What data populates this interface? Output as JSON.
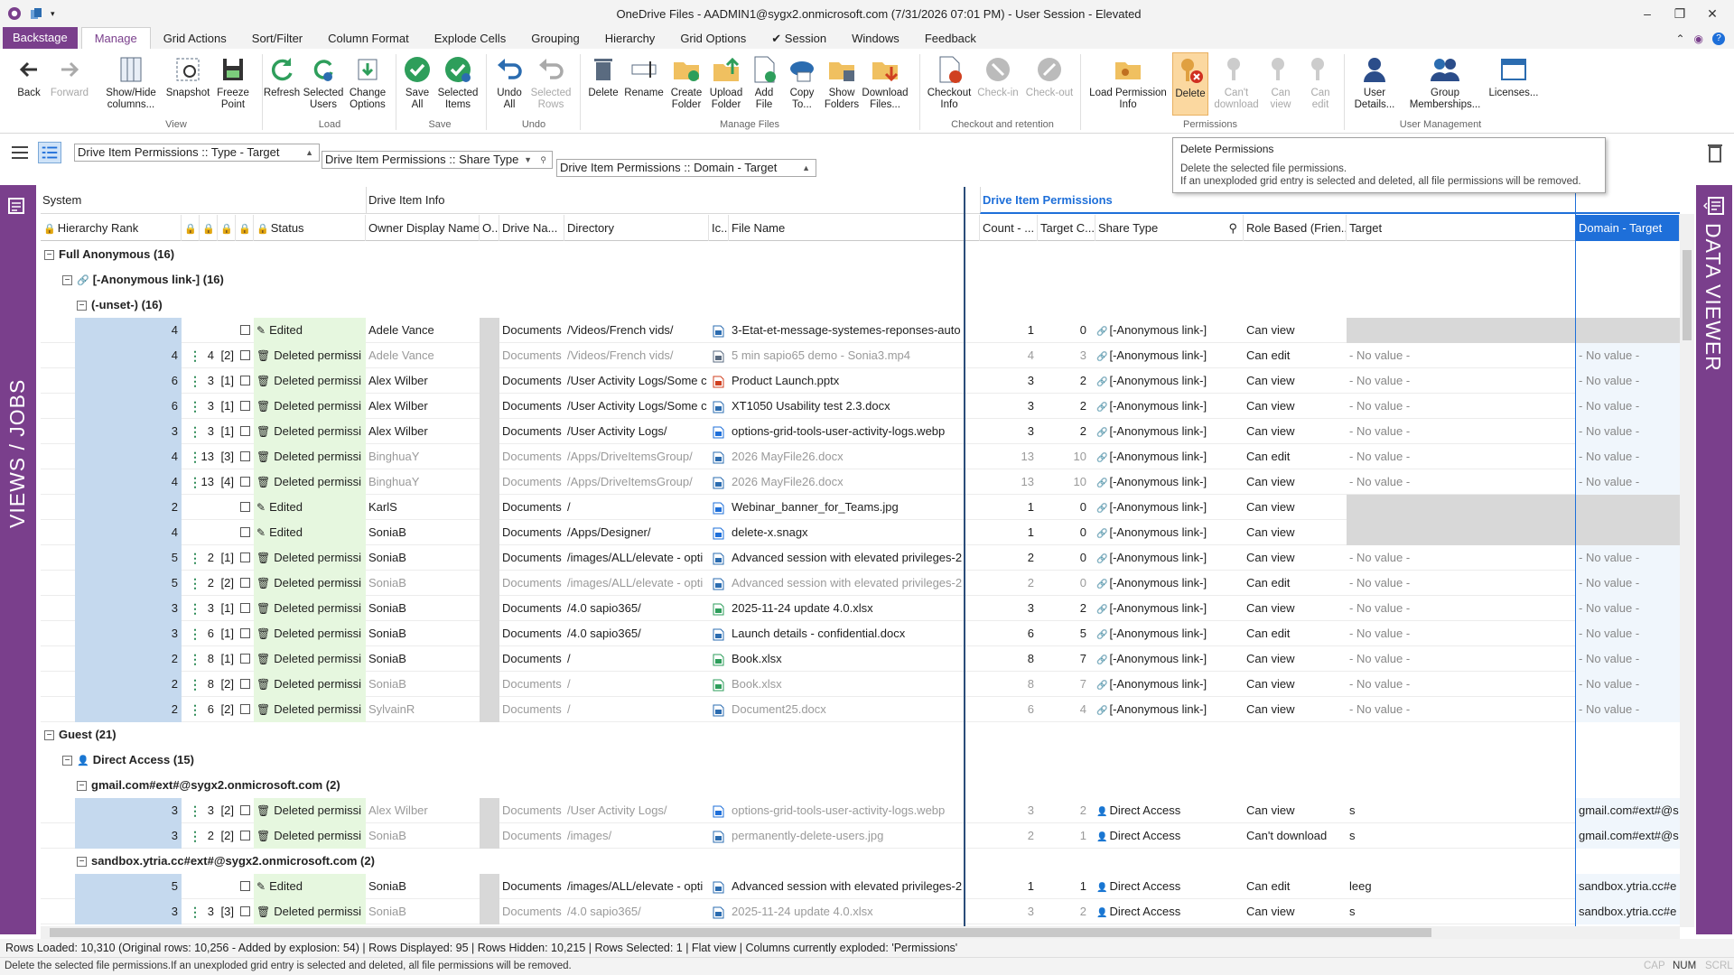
{
  "window": {
    "title": "OneDrive Files - AADMIN1@sygx2.onmicrosoft.com (7/31/2026 07:01 PM) - User Session - Elevated",
    "controls": [
      "–",
      "❐",
      "✕"
    ]
  },
  "tabs": [
    "Backstage",
    "Manage",
    "Grid Actions",
    "Sort/Filter",
    "Column Format",
    "Explode Cells",
    "Grouping",
    "Hierarchy",
    "Grid Options",
    "✔ Session",
    "Windows",
    "Feedback"
  ],
  "ribbon": {
    "groups": [
      "View",
      "Load",
      "Save",
      "Undo",
      "Manage Files",
      "Checkout and retention",
      "Permissions",
      "User Management"
    ],
    "buttons": {
      "back": "Back",
      "forward": "Forward",
      "show_hide": "Show/Hide columns...",
      "snapshot": "Snapshot",
      "freeze": "Freeze Point",
      "refresh": "Refresh",
      "selected_users": "Selected Users",
      "change_options": "Change Options",
      "save_all": "Save All",
      "selected_items": "Selected Items",
      "undo_all": "Undo All",
      "selected_rows": "Selected Rows",
      "delete_file": "Delete",
      "rename": "Rename",
      "create_folder": "Create Folder",
      "upload_folder": "Upload Folder",
      "add_file": "Add File",
      "copy_to": "Copy To...",
      "show_folders": "Show Folders",
      "download_files": "Download Files...",
      "checkout_info": "Checkout Info",
      "checkin": "Check-in",
      "checkout": "Check-out",
      "load_perm": "Load Permission Info",
      "delete_perm": "Delete",
      "cant_download": "Can't download",
      "can_view": "Can view",
      "can_edit": "Can edit",
      "user_details": "User Details...",
      "group_memberships": "Group Memberships...",
      "licenses": "Licenses..."
    }
  },
  "tooltip": {
    "title": "Delete Permissions",
    "line1": "Delete the selected file permissions.",
    "line2": "If an unexploded grid entry is selected and deleted, all file permissions will be removed."
  },
  "groupby": {
    "chip1": "Drive Item Permissions :: Type - Target",
    "chip2": "Drive Item Permissions :: Share Type",
    "chip3": "Drive Item Permissions :: Domain - Target"
  },
  "side": {
    "left": "VIEWS / JOBS",
    "right": "DATA VIEWER"
  },
  "grid": {
    "categories": [
      "System",
      "Drive Item Info",
      "Drive Item Permissions"
    ],
    "headers": {
      "hierarchy_rank": "Hierarchy Rank",
      "status": "Status",
      "owner": "Owner Display Name",
      "o": "O...",
      "drive_name": "Drive Na...",
      "directory": "Directory",
      "icon": "Ic...",
      "file_name": "File Name",
      "count": "Count - ...",
      "target_c": "Target C...",
      "share_type": "Share Type",
      "role": "Role Based (Frien...",
      "target": "Target",
      "domain": "Domain - Target"
    },
    "groups": {
      "full_anon": "Full Anonymous (16)",
      "anon_link": "[-Anonymous link-] (16)",
      "unset": "(-unset-) (16)",
      "guest": "Guest (21)",
      "direct": "Direct Access (15)",
      "gmail": "gmail.com#ext#@sygx2.onmicrosoft.com (2)",
      "sandbox": "sandbox.ytria.cc#ext#@sygx2.onmicrosoft.com (2)"
    },
    "rows_block1": [
      {
        "rank": "4",
        "a": "",
        "b": "",
        "status": "Edited",
        "owner": "Adele Vance",
        "drive": "Documents",
        "dir": "/Videos/French vids/",
        "file": "3-Etat-et-message-systemes-reponses-auto",
        "count": "1",
        "tc": "0",
        "share": "[-Anonymous link-]",
        "role": "Can view",
        "target": "",
        "domain": "",
        "dim": false,
        "tgrey": true
      },
      {
        "rank": "4",
        "a": "4",
        "b": "[2]",
        "status": "Deleted permissi",
        "owner": "Adele Vance",
        "drive": "Documents",
        "dir": "/Videos/French vids/",
        "file": "5 min sapio65 demo - Sonia3.mp4",
        "count": "4",
        "tc": "3",
        "share": "[-Anonymous link-]",
        "role": "Can edit",
        "target": "- No value -",
        "domain": "- No value -",
        "dim": true,
        "tgrey": false
      },
      {
        "rank": "6",
        "a": "3",
        "b": "[1]",
        "status": "Deleted permissi",
        "owner": "Alex Wilber",
        "drive": "Documents",
        "dir": "/User Activity Logs/Some c",
        "file": "Product Launch.pptx",
        "count": "3",
        "tc": "2",
        "share": "[-Anonymous link-]",
        "role": "Can view",
        "target": "- No value -",
        "domain": "- No value -",
        "dim": false,
        "tgrey": false
      },
      {
        "rank": "6",
        "a": "3",
        "b": "[1]",
        "status": "Deleted permissi",
        "owner": "Alex Wilber",
        "drive": "Documents",
        "dir": "/User Activity Logs/Some c",
        "file": "XT1050 Usability test 2.3.docx",
        "count": "3",
        "tc": "2",
        "share": "[-Anonymous link-]",
        "role": "Can view",
        "target": "- No value -",
        "domain": "- No value -",
        "dim": false,
        "tgrey": false
      },
      {
        "rank": "3",
        "a": "3",
        "b": "[1]",
        "status": "Deleted permissi",
        "owner": "Alex Wilber",
        "drive": "Documents",
        "dir": "/User Activity Logs/",
        "file": "options-grid-tools-user-activity-logs.webp",
        "count": "3",
        "tc": "2",
        "share": "[-Anonymous link-]",
        "role": "Can view",
        "target": "- No value -",
        "domain": "- No value -",
        "dim": false,
        "tgrey": false
      },
      {
        "rank": "4",
        "a": "13",
        "b": "[3]",
        "status": "Deleted permissi",
        "owner": "BinghuaY",
        "drive": "Documents",
        "dir": "/Apps/DriveItemsGroup/",
        "file": "2026 MayFile26.docx",
        "count": "13",
        "tc": "10",
        "share": "[-Anonymous link-]",
        "role": "Can edit",
        "target": "- No value -",
        "domain": "- No value -",
        "dim": true,
        "tgrey": false
      },
      {
        "rank": "4",
        "a": "13",
        "b": "[4]",
        "status": "Deleted permissi",
        "owner": "BinghuaY",
        "drive": "Documents",
        "dir": "/Apps/DriveItemsGroup/",
        "file": "2026 MayFile26.docx",
        "count": "13",
        "tc": "10",
        "share": "[-Anonymous link-]",
        "role": "Can view",
        "target": "- No value -",
        "domain": "- No value -",
        "dim": true,
        "tgrey": false
      },
      {
        "rank": "2",
        "a": "",
        "b": "",
        "status": "Edited",
        "owner": "KarlS",
        "drive": "Documents",
        "dir": "/",
        "file": "Webinar_banner_for_Teams.jpg",
        "count": "1",
        "tc": "0",
        "share": "[-Anonymous link-]",
        "role": "Can view",
        "target": "",
        "domain": "",
        "dim": false,
        "tgrey": true
      },
      {
        "rank": "4",
        "a": "",
        "b": "",
        "status": "Edited",
        "owner": "SoniaB",
        "drive": "Documents",
        "dir": "/Apps/Designer/",
        "file": "delete-x.snagx",
        "count": "1",
        "tc": "0",
        "share": "[-Anonymous link-]",
        "role": "Can view",
        "target": "",
        "domain": "",
        "dim": false,
        "tgrey": true
      },
      {
        "rank": "5",
        "a": "2",
        "b": "[1]",
        "status": "Deleted permissi",
        "owner": "SoniaB",
        "drive": "Documents",
        "dir": "/images/ALL/elevate - opti",
        "file": "Advanced session with elevated privileges-2",
        "count": "2",
        "tc": "0",
        "share": "[-Anonymous link-]",
        "role": "Can view",
        "target": "- No value -",
        "domain": "- No value -",
        "dim": false,
        "tgrey": false
      },
      {
        "rank": "5",
        "a": "2",
        "b": "[2]",
        "status": "Deleted permissi",
        "owner": "SoniaB",
        "drive": "Documents",
        "dir": "/images/ALL/elevate - opti",
        "file": "Advanced session with elevated privileges-2",
        "count": "2",
        "tc": "0",
        "share": "[-Anonymous link-]",
        "role": "Can edit",
        "target": "- No value -",
        "domain": "- No value -",
        "dim": true,
        "tgrey": false
      },
      {
        "rank": "3",
        "a": "3",
        "b": "[1]",
        "status": "Deleted permissi",
        "owner": "SoniaB",
        "drive": "Documents",
        "dir": "/4.0 sapio365/",
        "file": "2025-11-24 update 4.0.xlsx",
        "count": "3",
        "tc": "2",
        "share": "[-Anonymous link-]",
        "role": "Can view",
        "target": "- No value -",
        "domain": "- No value -",
        "dim": false,
        "tgrey": false
      },
      {
        "rank": "3",
        "a": "6",
        "b": "[1]",
        "status": "Deleted permissi",
        "owner": "SoniaB",
        "drive": "Documents",
        "dir": "/4.0 sapio365/",
        "file": "Launch details - confidential.docx",
        "count": "6",
        "tc": "5",
        "share": "[-Anonymous link-]",
        "role": "Can edit",
        "target": "- No value -",
        "domain": "- No value -",
        "dim": false,
        "tgrey": false
      },
      {
        "rank": "2",
        "a": "8",
        "b": "[1]",
        "status": "Deleted permissi",
        "owner": "SoniaB",
        "drive": "Documents",
        "dir": "/",
        "file": "Book.xlsx",
        "count": "8",
        "tc": "7",
        "share": "[-Anonymous link-]",
        "role": "Can view",
        "target": "- No value -",
        "domain": "- No value -",
        "dim": false,
        "tgrey": false
      },
      {
        "rank": "2",
        "a": "8",
        "b": "[2]",
        "status": "Deleted permissi",
        "owner": "SoniaB",
        "drive": "Documents",
        "dir": "/",
        "file": "Book.xlsx",
        "count": "8",
        "tc": "7",
        "share": "[-Anonymous link-]",
        "role": "Can view",
        "target": "- No value -",
        "domain": "- No value -",
        "dim": true,
        "tgrey": false
      },
      {
        "rank": "2",
        "a": "6",
        "b": "[2]",
        "status": "Deleted permissi",
        "owner": "SylvainR",
        "drive": "Documents",
        "dir": "/",
        "file": "Document25.docx",
        "count": "6",
        "tc": "4",
        "share": "[-Anonymous link-]",
        "role": "Can view",
        "target": "- No value -",
        "domain": "- No value -",
        "dim": true,
        "tgrey": false
      }
    ],
    "rows_gmail": [
      {
        "rank": "3",
        "a": "3",
        "b": "[2]",
        "status": "Deleted permissi",
        "owner": "Alex Wilber",
        "drive": "Documents",
        "dir": "/User Activity Logs/",
        "file": "options-grid-tools-user-activity-logs.webp",
        "count": "3",
        "tc": "2",
        "share": "Direct Access",
        "role": "Can view",
        "target": "s",
        "domain": "gmail.com#ext#@s",
        "dim": true,
        "tgrey": false
      },
      {
        "rank": "3",
        "a": "2",
        "b": "[2]",
        "status": "Deleted permissi",
        "owner": "SoniaB",
        "drive": "Documents",
        "dir": "/images/",
        "file": "permanently-delete-users.jpg",
        "count": "2",
        "tc": "1",
        "share": "Direct Access",
        "role": "Can't download",
        "target": "s",
        "domain": "gmail.com#ext#@s",
        "dim": true,
        "tgrey": false
      }
    ],
    "rows_sandbox": [
      {
        "rank": "5",
        "a": "",
        "b": "",
        "status": "Edited",
        "owner": "SoniaB",
        "drive": "Documents",
        "dir": "/images/ALL/elevate - opti",
        "file": "Advanced session with elevated privileges-2",
        "count": "1",
        "tc": "1",
        "share": "Direct Access",
        "role": "Can edit",
        "target": "leeg",
        "domain": "sandbox.ytria.cc#e",
        "dim": false,
        "tgrey": false
      },
      {
        "rank": "3",
        "a": "3",
        "b": "[3]",
        "status": "Deleted permissi",
        "owner": "SoniaB",
        "drive": "Documents",
        "dir": "/4.0 sapio365/",
        "file": "2025-11-24 update 4.0.xlsx",
        "count": "3",
        "tc": "2",
        "share": "Direct Access",
        "role": "Can view",
        "target": "s",
        "domain": "sandbox.ytria.cc#e",
        "dim": true,
        "tgrey": false
      }
    ]
  },
  "status": {
    "main": "Rows Loaded: 10,310 (Original rows: 10,256 - Added by explosion: 54) | Rows Displayed: 95 | Rows Hidden: 10,215 | Rows Selected: 1 | Flat view | Columns currently exploded: 'Permissions'",
    "hint": "Delete the selected file permissions.If an unexploded grid entry is selected and deleted, all file permissions will be removed.",
    "cap": "CAP",
    "num": "NUM",
    "scrl": "SCRL"
  },
  "colors": {
    "brand": "#7a3f8c",
    "accent": "#1e6fd9",
    "rank_bg": "#c5d9ee",
    "status_bg": "#e6f7df"
  }
}
